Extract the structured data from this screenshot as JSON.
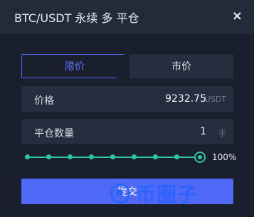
{
  "dialog": {
    "title": "BTC/USDT 永续 多 平仓",
    "close_label": "×",
    "tabs": [
      {
        "label": "限价",
        "active": true
      },
      {
        "label": "市价",
        "active": false
      }
    ],
    "price": {
      "label": "价格",
      "value": "9232.75",
      "unit": "USDT"
    },
    "close_amount": {
      "label": "平仓数量",
      "value": "1",
      "unit": "手"
    },
    "slider": {
      "percent_label": "100%",
      "fill": 1.0
    },
    "submit_label": "提交",
    "watermark_text": "币圈子"
  },
  "colors": {
    "background": "#1a1f2e",
    "header": "#232a3a",
    "accent": "#4f68f6",
    "slider": "#2cc79d"
  }
}
